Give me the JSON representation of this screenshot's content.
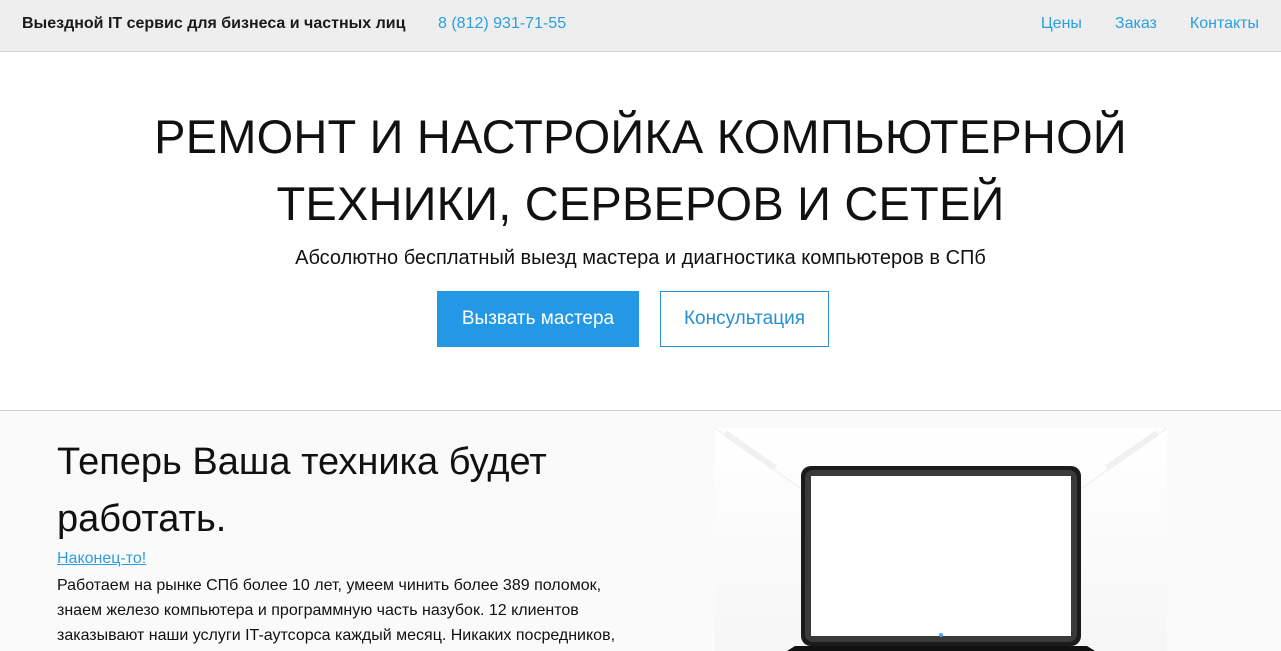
{
  "header": {
    "brand": "Выездной IT сервис для бизнеса и частных лиц",
    "phone": "8 (812) 931-71-55",
    "nav": [
      {
        "label": "Цены"
      },
      {
        "label": "Заказ"
      },
      {
        "label": "Контакты"
      }
    ]
  },
  "hero": {
    "title_line1": "РЕМОНТ И НАСТРОЙКА КОМПЬЮТЕРНОЙ",
    "title_line2": "ТЕХНИКИ, СЕРВЕРОВ И СЕТЕЙ",
    "subtitle": "Абсолютно бесплатный выезд мастера и диагностика компьютеров в СПб",
    "primary_button": "Вызвать мастера",
    "secondary_button": "Консультация"
  },
  "feature": {
    "heading": "Теперь Ваша техника будет работать.",
    "tagline": "Наконец-то!",
    "body_line1": "Работаем на рынке СПб более 10 лет, умеем чинить более 389 поломок,",
    "body_line2": "знаем железо компьютера и программную часть назубок. 12 клиентов",
    "body_line3": "заказывают наши услуги IT-аутсорса каждый месяц. Никаких посредников,",
    "image_icon": "laptop-icon"
  },
  "colors": {
    "accent": "#2399e5",
    "link": "#2a9fe0",
    "topbar": "#eeeeee"
  }
}
